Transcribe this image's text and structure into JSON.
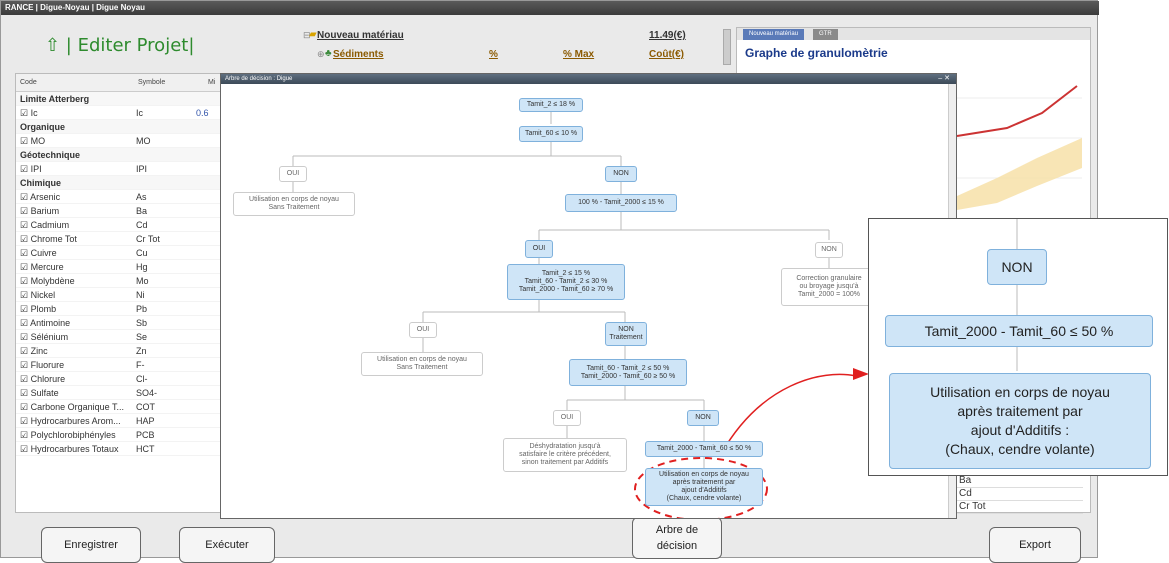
{
  "window": {
    "title": "RANCE | Digue-Noyau | Digue Noyau"
  },
  "header": {
    "edit_title": "⇧ | Editer Projet|"
  },
  "materials": {
    "new_material": "Nouveau matériau",
    "price": "11.49(€)",
    "sediments": "Sédiments",
    "pct": "%",
    "pct_max": "% Max",
    "cost": "Coût(€)"
  },
  "left_table": {
    "headers": [
      "Code",
      "Symbole",
      "Mi"
    ],
    "rows": [
      {
        "code": "Limite Atterberg",
        "symbol": "",
        "value": "",
        "group": true
      },
      {
        "code": "☑ Ic",
        "symbol": "Ic",
        "value": "0.6",
        "group": false
      },
      {
        "code": "Organique",
        "symbol": "",
        "value": "",
        "group": true
      },
      {
        "code": "☑ MO",
        "symbol": "MO",
        "value": "",
        "group": false
      },
      {
        "code": "Géotechnique",
        "symbol": "",
        "value": "",
        "group": true
      },
      {
        "code": "☑ IPI",
        "symbol": "IPI",
        "value": "",
        "group": false
      },
      {
        "code": "Chimique",
        "symbol": "",
        "value": "",
        "group": true
      },
      {
        "code": "☑ Arsenic",
        "symbol": "As",
        "value": "",
        "group": false
      },
      {
        "code": "☑ Barium",
        "symbol": "Ba",
        "value": "",
        "group": false
      },
      {
        "code": "☑ Cadmium",
        "symbol": "Cd",
        "value": "",
        "group": false
      },
      {
        "code": "☑ Chrome Tot",
        "symbol": "Cr Tot",
        "value": "",
        "group": false
      },
      {
        "code": "☑ Cuivre",
        "symbol": "Cu",
        "value": "",
        "group": false
      },
      {
        "code": "☑ Mercure",
        "symbol": "Hg",
        "value": "",
        "group": false
      },
      {
        "code": "☑ Molybdène",
        "symbol": "Mo",
        "value": "",
        "group": false
      },
      {
        "code": "☑ Nickel",
        "symbol": "Ni",
        "value": "",
        "group": false
      },
      {
        "code": "☑ Plomb",
        "symbol": "Pb",
        "value": "",
        "group": false
      },
      {
        "code": "☑ Antimoine",
        "symbol": "Sb",
        "value": "",
        "group": false
      },
      {
        "code": "☑ Sélénium",
        "symbol": "Se",
        "value": "",
        "group": false
      },
      {
        "code": "☑ Zinc",
        "symbol": "Zn",
        "value": "",
        "group": false
      },
      {
        "code": "☑ Fluorure",
        "symbol": "F-",
        "value": "",
        "group": false
      },
      {
        "code": "☑ Chlorure",
        "symbol": "Cl-",
        "value": "",
        "group": false
      },
      {
        "code": "☑ Sulfate",
        "symbol": "SO4-",
        "value": "",
        "group": false
      },
      {
        "code": "☑ Carbone Organique T...",
        "symbol": "COT",
        "value": "",
        "group": false
      },
      {
        "code": "☑ Hydrocarbures Arom...",
        "symbol": "HAP",
        "value": "",
        "group": false
      },
      {
        "code": "☑ Polychlorobiphényles",
        "symbol": "PCB",
        "value": "",
        "group": false
      },
      {
        "code": "☑ Hydrocarbures Totaux",
        "symbol": "HCT",
        "value": "",
        "group": false
      }
    ]
  },
  "right_panel": {
    "tabs": [
      "Nouveau matériau",
      "GTR"
    ],
    "graph_title": "Graphe de granulomètrie",
    "bottom_list": [
      "Ba",
      "Cd",
      "Cr Tot"
    ]
  },
  "dialog": {
    "title": "Arbre de décision : Digue",
    "controls": "– ✕",
    "nodes": {
      "n1": "Tamit_2 ≤ 18 %",
      "n2": "Tamit_60 ≤ 10 %",
      "n3_oui": "OUI",
      "n3_non": "NON",
      "n4_oui_text": "Utilisation en corps de noyau\nSans Traitement",
      "n4_non": "100 % - Tamit_2000 ≤ 15 %",
      "n5_oui": "OUI",
      "n5_non": "NON",
      "n6_cond": "Tamit_2 ≤ 15 %\nTamit_60 - Tamit_2 ≤ 30 %\nTamit_2000 - Tamit_60 ≥ 70 %",
      "n6_non_text": "Correction granulaire\nou broyage jusqu'à\nTamit_2000 = 100%",
      "n7_oui": "OUI",
      "n7_non": "NON\nTraitement",
      "n8_oui_text": "Utilisation en corps de noyau\nSans Traitement",
      "n8_cond": "Tamit_60 - Tamit_2 ≤ 50 %\nTamit_2000 - Tamit_60 ≥ 50 %",
      "n9_oui": "OUI",
      "n9_non": "NON",
      "n10_oui_text": "Déshydratation jusqu'à\nsatisfaire le critère précédent,\nsinon traitement par Additifs",
      "n10_non": "Tamit_2000 - Tamit_60 ≤ 50 %",
      "n11": "Utilisation en corps de noyau\naprès traitement par\najout d'Additifs\n(Chaux, cendre volante)"
    }
  },
  "zoom": {
    "non": "NON",
    "cond": "Tamit_2000 - Tamit_60 ≤ 50 %",
    "result": "Utilisation en corps de noyau\naprès traitement par\najout d'Additifs :\n(Chaux, cendre volante)"
  },
  "buttons": {
    "save": "Enregistrer",
    "run": "Exécuter",
    "tree": "Arbre de\ndécision",
    "export": "Export"
  },
  "colors": {
    "accent_blue": "#cfe5f7",
    "highlight_red": "#e02020",
    "title_green": "#2e8b2e"
  }
}
